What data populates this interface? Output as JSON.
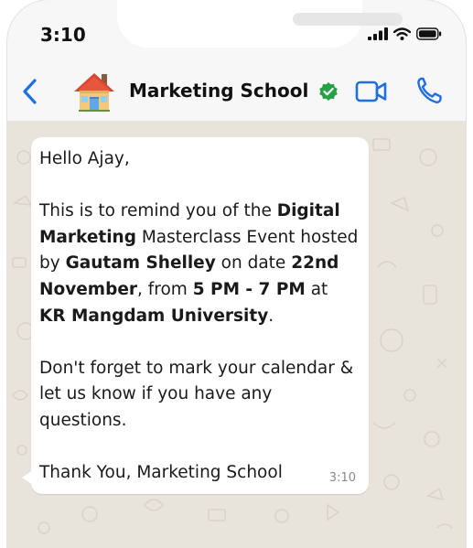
{
  "status_bar": {
    "time": "3:10"
  },
  "header": {
    "back_icon": "chevron-left-icon",
    "avatar_icon": "house-emoji-icon",
    "contact_name": "Marketing School",
    "verified_icon": "verified-check-icon",
    "video_icon": "video-camera-icon",
    "call_icon": "phone-icon"
  },
  "message": {
    "greeting": "Hello Ajay,",
    "p2_1": "This is to remind you of the ",
    "p2_2": "Digital Marketing",
    "p2_3": " Masterclass Event hosted by ",
    "p2_4": "Gautam Shelley",
    "p2_5": " on date ",
    "p2_6": "22nd November",
    "p2_7": ", from ",
    "p2_8": "5 PM - 7 PM",
    "p2_9": " at ",
    "p2_10": "KR Mangdam University",
    "p2_11": ".",
    "p3": "Don't forget to mark your calendar & let us know if you have any questions.",
    "signoff": "Thank You, Marketing School",
    "time": "3:10"
  },
  "colors": {
    "accent_blue": "#1f6fe0",
    "verified_green": "#25a244",
    "chat_background": "#e8e3db",
    "bubble": "#ffffff"
  }
}
